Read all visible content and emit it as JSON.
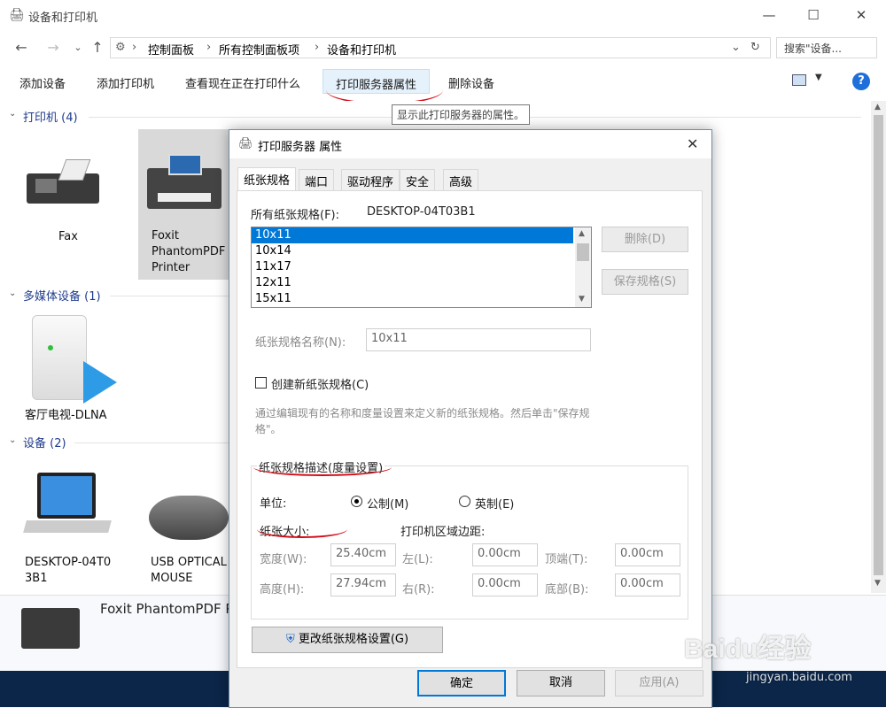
{
  "window": {
    "title": "设备和打印机"
  },
  "nav": {
    "crumbs": [
      "控制面板",
      "所有控制面板项",
      "设备和打印机"
    ],
    "search_placeholder": "搜索\"设备..."
  },
  "commands": [
    "添加设备",
    "添加打印机",
    "查看现在正在打印什么",
    "打印服务器属性",
    "删除设备"
  ],
  "tooltip": "显示此打印服务器的属性。",
  "groups": {
    "printers": {
      "title": "打印机 (4)",
      "items": [
        "Fax",
        "Foxit PhantomPDF Printer"
      ]
    },
    "media": {
      "title": "多媒体设备 (1)",
      "items": [
        "客厅电视-DLNA"
      ]
    },
    "devices": {
      "title": "设备 (2)",
      "items": [
        "DESKTOP-04T03B1",
        "USB OPTICAL MOUSE"
      ]
    }
  },
  "details": {
    "name": "Foxit PhantomPDF P"
  },
  "dialog": {
    "title": "打印服务器 属性",
    "tabs": [
      "纸张规格",
      "端口",
      "驱动程序",
      "安全",
      "高级"
    ],
    "all_forms_label": "所有纸张规格(F):",
    "server_name": "DESKTOP-04T03B1",
    "forms": [
      "10x11",
      "10x14",
      "11x17",
      "12x11",
      "15x11"
    ],
    "delete_btn": "删除(D)",
    "save_btn": "保存规格(S)",
    "form_name_label": "纸张规格名称(N):",
    "form_name_value": "10x11",
    "create_new_label": "创建新纸张规格(C)",
    "hint": "通过编辑现有的名称和度量设置来定义新的纸张规格。然后单击\"保存规格\"。",
    "desc_group": "纸张规格描述(度量设置)",
    "unit_label": "单位:",
    "metric": "公制(M)",
    "english": "英制(E)",
    "paper_size": "纸张大小:",
    "margins": "打印机区域边距:",
    "width_label": "宽度(W):",
    "width": "25.40cm",
    "height_label": "高度(H):",
    "height": "27.94cm",
    "left_label": "左(L):",
    "left": "0.00cm",
    "right_label": "右(R):",
    "right": "0.00cm",
    "top_label": "顶端(T):",
    "top": "0.00cm",
    "bottom_label": "底部(B):",
    "bottom": "0.00cm",
    "change_btn": "更改纸张规格设置(G)",
    "ok": "确定",
    "cancel": "取消",
    "apply": "应用(A)"
  },
  "watermark": {
    "brand": "Baidu经验",
    "url": "jingyan.baidu.com"
  }
}
